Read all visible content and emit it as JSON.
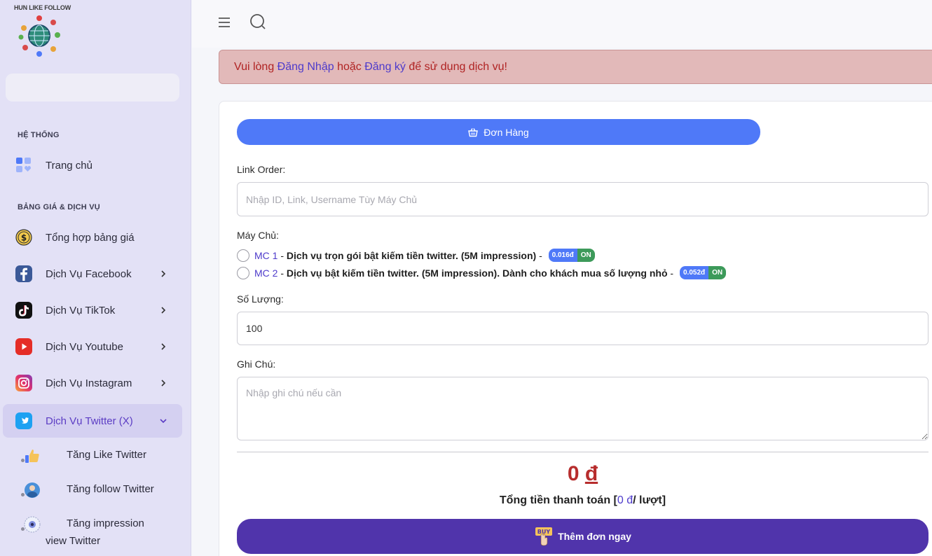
{
  "brand": {
    "logo_text": "HUN LIKE FOLLOW"
  },
  "sidebar": {
    "section_system": "HỆ THỐNG",
    "home": "Trang chủ",
    "section_pricing": "BẢNG GIÁ & DỊCH VỤ",
    "items": [
      {
        "label": "Tổng hợp bảng giá",
        "icon": "dollar-coin-icon"
      },
      {
        "label": "Dịch Vụ Facebook",
        "icon": "facebook-icon"
      },
      {
        "label": "Dịch Vụ TikTok",
        "icon": "tiktok-icon"
      },
      {
        "label": "Dịch Vụ Youtube",
        "icon": "youtube-icon"
      },
      {
        "label": "Dịch Vụ Instagram",
        "icon": "instagram-icon"
      },
      {
        "label": "Dịch Vụ Twitter (X)",
        "icon": "twitter-icon",
        "active": true
      }
    ],
    "sub_items": [
      {
        "label": "Tăng Like Twitter",
        "icon": "thumbs-up-icon"
      },
      {
        "label": "Tăng follow Twitter",
        "icon": "user-icon"
      },
      {
        "label_line1": "Tăng impression",
        "label_line2": "view Twitter",
        "icon": "eye-icon"
      }
    ]
  },
  "alert": {
    "prefix": "Vui lòng ",
    "login": "Đăng Nhập",
    "middle": " hoặc ",
    "register": "Đăng ký",
    "suffix": " để sử dụng dịch vụ!"
  },
  "order": {
    "button_label": "Đơn Hàng",
    "link_label": "Link Order:",
    "link_placeholder": "Nhập ID, Link, Username Tùy Máy Chủ",
    "server_label": "Máy Chủ:",
    "servers": [
      {
        "code": "MC 1",
        "sep": " - ",
        "desc": "Dịch vụ trọn gói bật kiếm tiền twitter. (5M impression)",
        "dash": " - ",
        "price": "0.016đ",
        "status": "ON"
      },
      {
        "code": "MC 2",
        "sep": " - ",
        "desc": "Dịch vụ bật kiếm tiền twitter. (5M impression). Dành cho khách mua số lượng nhỏ",
        "dash": " - ",
        "price": "0.052đ",
        "status": "ON"
      }
    ],
    "quantity_label": "Số Lượng:",
    "quantity_value": "100",
    "note_label": "Ghi Chú:",
    "note_placeholder": "Nhập ghi chú nếu cần",
    "total_amount": "0",
    "total_currency": "đ",
    "total_text_prefix": "Tổng tiền thanh toán [",
    "total_text_value": "0 đ",
    "total_text_suffix": "/ lượt]",
    "add_button": "Thêm đơn ngay"
  },
  "colors": {
    "primary_blue": "#4f79f8",
    "purple": "#5034ab",
    "alert_bg": "#e2b9b9",
    "alert_text": "#b02323",
    "price_red": "#b72d2d"
  }
}
